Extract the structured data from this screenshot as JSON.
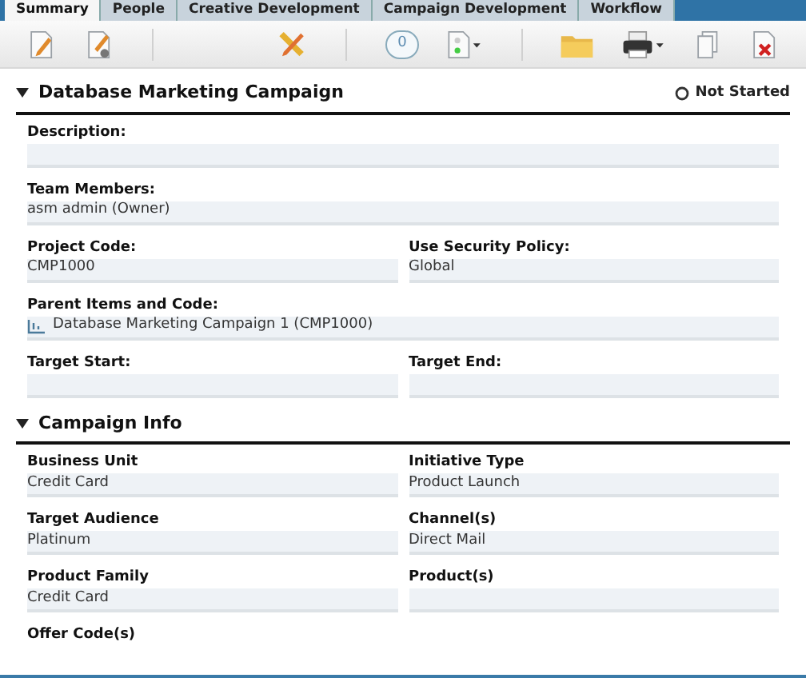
{
  "tabs": [
    {
      "label": "Summary",
      "selected": true
    },
    {
      "label": "People",
      "selected": false
    },
    {
      "label": "Creative Development",
      "selected": false
    },
    {
      "label": "Campaign Development",
      "selected": false
    },
    {
      "label": "Workflow",
      "selected": false
    }
  ],
  "toolbar": {
    "comment_count": "0"
  },
  "sections": [
    {
      "title": "Database Marketing Campaign",
      "expanded": true,
      "status": "Not Started",
      "fields": [
        {
          "label": "Description:",
          "wide": true,
          "kind": "text"
        },
        {
          "label": "Team Members:",
          "value": "asm admin (Owner)",
          "wide": true,
          "kind": "text"
        },
        {
          "label": "Project Code:",
          "value": "CMP1000",
          "wide": false,
          "kind": "text"
        },
        {
          "label": "Use Security Policy:",
          "value": "Global",
          "wide": false,
          "kind": "text"
        },
        {
          "label": "Parent Items and Code:",
          "value": "Database Marketing Campaign 1 (CMP1000)",
          "wide": true,
          "kind": "parent"
        },
        {
          "label": "Target Start:",
          "wide": false,
          "kind": "text"
        },
        {
          "label": "Target End:",
          "wide": false,
          "kind": "text"
        }
      ]
    },
    {
      "title": "Campaign Info",
      "expanded": true,
      "fields": [
        {
          "label": "Business Unit",
          "value": "Credit Card",
          "wide": false,
          "kind": "text"
        },
        {
          "label": "Initiative Type",
          "value": "Product Launch",
          "wide": false,
          "kind": "text"
        },
        {
          "label": "Target Audience",
          "value": "Platinum",
          "wide": false,
          "kind": "text"
        },
        {
          "label": "Channel(s)",
          "value": "Direct Mail",
          "wide": false,
          "kind": "text"
        },
        {
          "label": "Product Family",
          "value": "Credit Card",
          "wide": false,
          "kind": "text"
        },
        {
          "label": "Product(s)",
          "wide": false,
          "kind": "text"
        },
        {
          "label": "Offer Code(s)",
          "wide": false,
          "kind": "cut"
        }
      ]
    }
  ]
}
